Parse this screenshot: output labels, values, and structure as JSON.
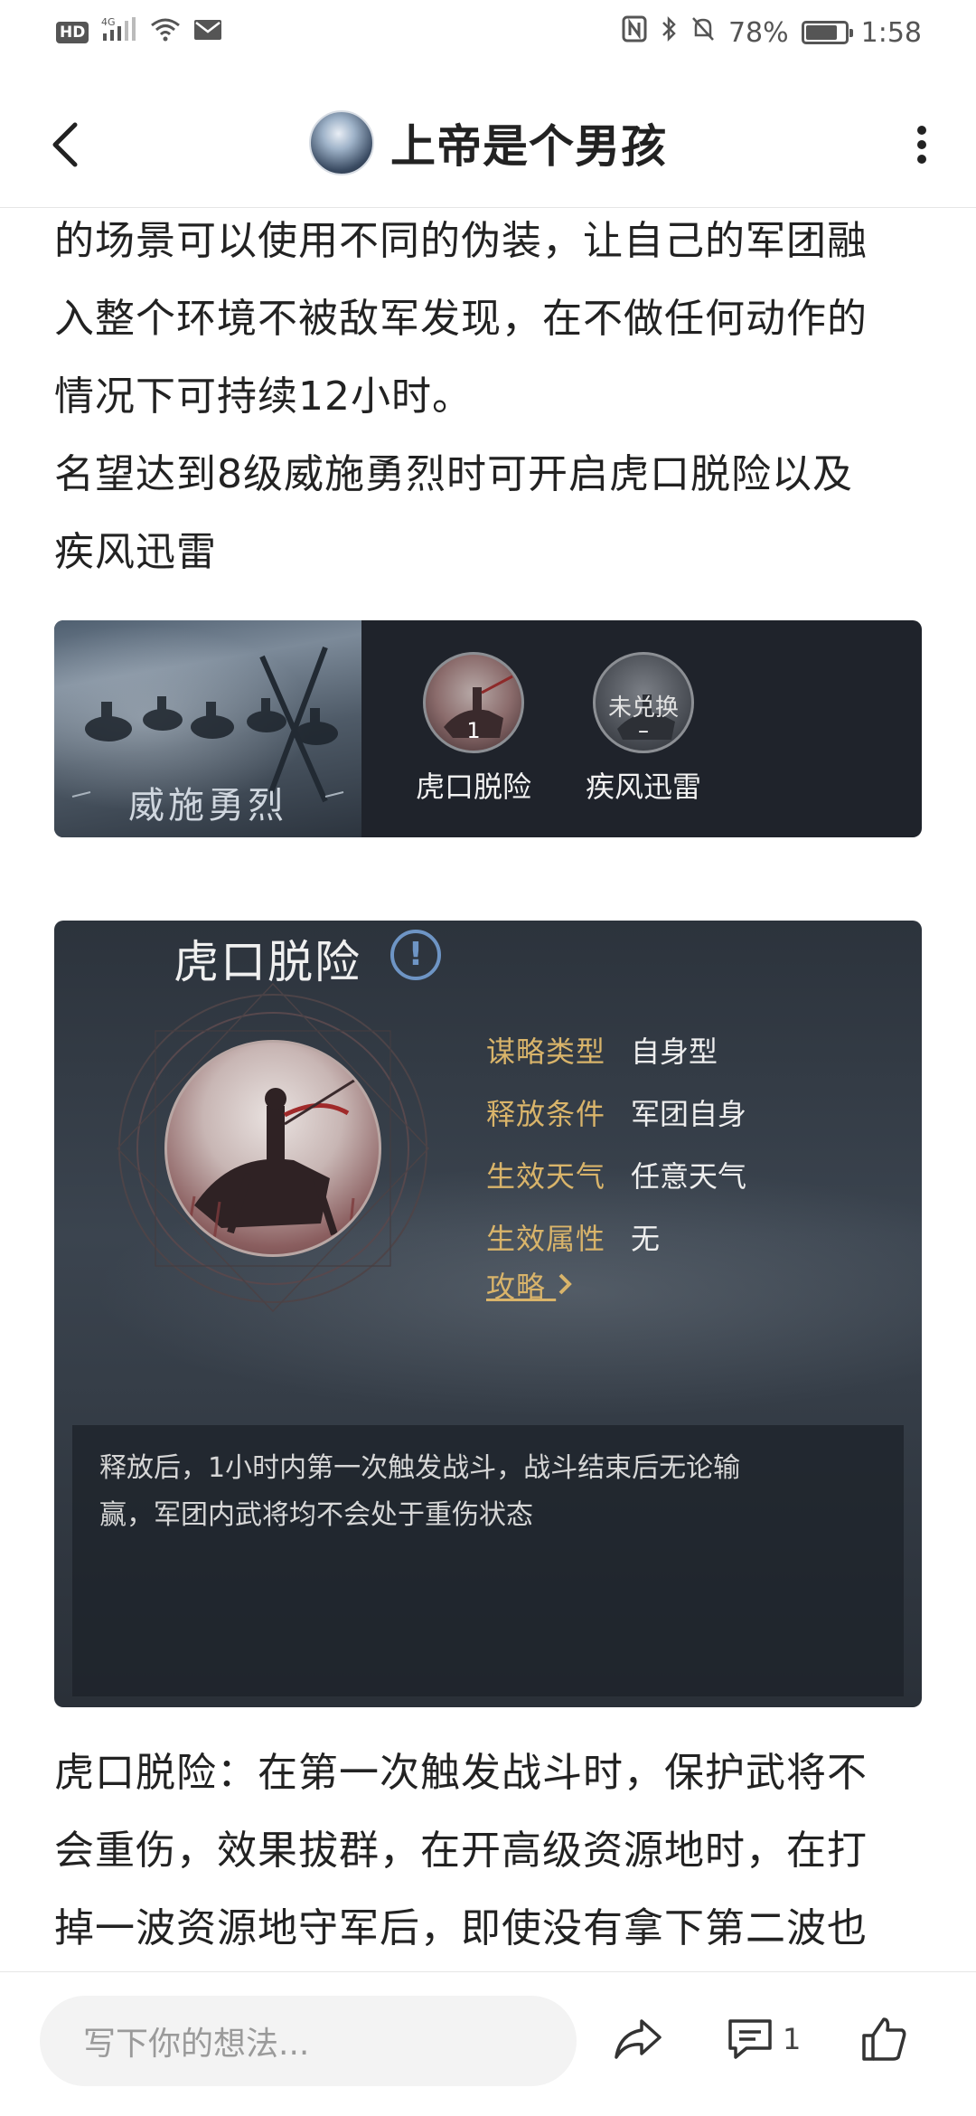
{
  "status_bar": {
    "left_badges": [
      "HD",
      "4G"
    ],
    "battery": "78%",
    "time": "1:58"
  },
  "header": {
    "author_name": "上帝是个男孩"
  },
  "article": {
    "para1_lines": [
      "的场景可以使用不同的伪装，让自己的军团融",
      "入整个环境不被敌军发现，在不做任何动作的",
      "情况下可持续12小时。",
      "名望达到8级威施勇烈时可开启虎口脱险以及",
      "疾风迅雷"
    ],
    "para3_lines": [
      "虎口脱险：在第一次触发战斗时，保护武将不",
      "会重伤，效果拔群，在开高级资源地时，在打",
      "掉一波资源地守军后，即使没有拿下第二波也"
    ]
  },
  "banner": {
    "title": "威施勇烈",
    "skills": [
      {
        "label": "虎口脱险",
        "badge": "1",
        "icon": "cavalry-skill-icon"
      },
      {
        "label": "疾风迅雷",
        "badge": "–",
        "overlay": "未兑换",
        "icon": "locked-skill-icon"
      }
    ]
  },
  "skill_card": {
    "title": "虎口脱险",
    "info_glyph": "!",
    "attributes": [
      {
        "key": "谋略类型",
        "value": "自身型"
      },
      {
        "key": "释放条件",
        "value": "军团自身"
      },
      {
        "key": "生效天气",
        "value": "任意天气"
      },
      {
        "key": "生效属性",
        "value": "无"
      }
    ],
    "strategy_link": "攻略",
    "description_lines": [
      "释放后，1小时内第一次触发战斗，战斗结束后无论输",
      "赢，军团内武将均不会处于重伤状态"
    ]
  },
  "bottom_bar": {
    "comment_placeholder": "写下你的想法...",
    "comment_count": "1"
  },
  "colors": {
    "accent_gold": "#d9b46a",
    "info_blue": "#6e95c5",
    "card_bg": "#2c333c"
  }
}
